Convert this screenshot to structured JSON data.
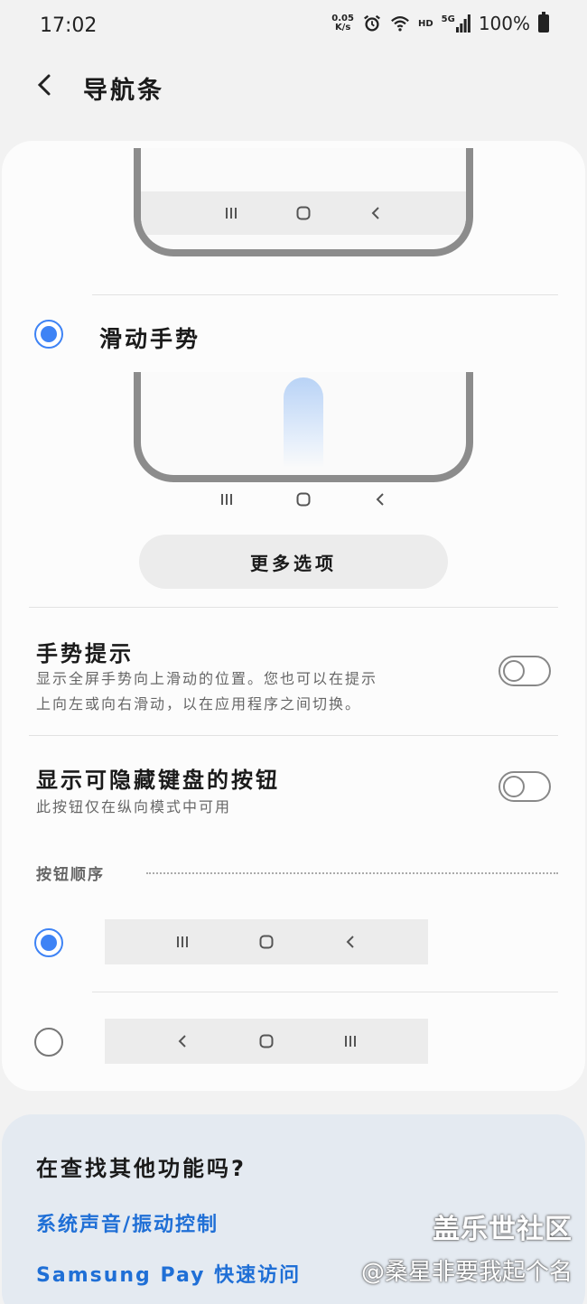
{
  "status_bar": {
    "time": "17:02",
    "speed_value": "0.05",
    "speed_unit": "K/s",
    "network": "HD",
    "signal": "5G",
    "battery": "100%"
  },
  "header": {
    "back_icon": "back-chevron-icon",
    "title": "导航条"
  },
  "nav_style": {
    "button_nav_icons": [
      "recents-icon",
      "home-icon",
      "back-icon"
    ],
    "swipe_option_label": "滑动手势",
    "swipe_option_selected": true,
    "more_options_label": "更多选项"
  },
  "settings": {
    "gesture_hint": {
      "title": "手势提示",
      "desc_line1": "显示全屏手势向上滑动的位置。您也可以在提示",
      "desc_line2": "上向左或向右滑动，以在应用程序之间切换。",
      "enabled": false
    },
    "keyboard_button": {
      "title": "显示可隐藏键盘的按钮",
      "desc": "此按钮仅在纵向模式中可用",
      "enabled": false
    }
  },
  "button_order": {
    "section_label": "按钮顺序",
    "options": [
      {
        "icons": [
          "recents-icon",
          "home-icon",
          "back-icon"
        ],
        "selected": true
      },
      {
        "icons": [
          "back-icon",
          "home-icon",
          "recents-icon"
        ],
        "selected": false
      }
    ]
  },
  "suggestions": {
    "title": "在查找其他功能吗?",
    "links": [
      "系统声音/振动控制",
      "Samsung Pay 快速访问"
    ]
  },
  "watermark": {
    "line1": "盖乐世社区",
    "line2": "@桑星非要我起个名"
  },
  "colors": {
    "accent": "#3e83f5",
    "link": "#1f6fd6",
    "background": "#f2f2f2",
    "card": "#fcfcfc",
    "suggest_card": "#e4eaf1"
  }
}
